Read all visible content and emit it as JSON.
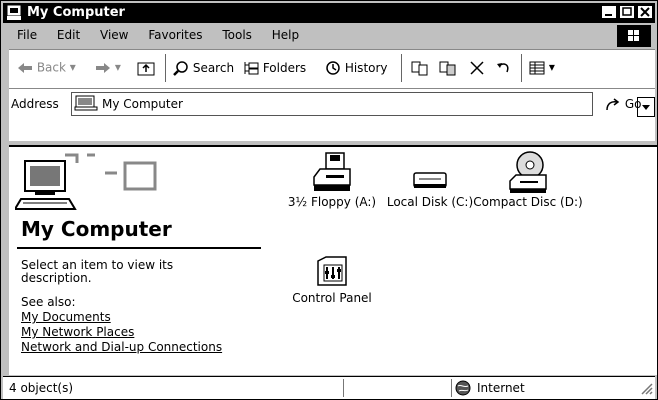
{
  "window": {
    "title": "My Computer"
  },
  "menu": [
    "File",
    "Edit",
    "View",
    "Favorites",
    "Tools",
    "Help"
  ],
  "toolbar": {
    "back": "Back",
    "search": "Search",
    "folders": "Folders",
    "history": "History"
  },
  "address": {
    "label": "Address",
    "value": "My Computer",
    "go": "Go"
  },
  "left_pane": {
    "title": "My Computer",
    "description": "Select an item to view its description.",
    "see_also": "See also:",
    "links": [
      "My Documents",
      "My Network Places",
      "Network and Dial-up Connections"
    ]
  },
  "items": [
    {
      "label": "3½ Floppy (A:)",
      "icon": "floppy-drive-icon"
    },
    {
      "label": "Local Disk (C:)",
      "icon": "hard-disk-icon"
    },
    {
      "label": "Compact Disc (D:)",
      "icon": "cd-drive-icon"
    },
    {
      "label": "Control Panel",
      "icon": "control-panel-icon"
    }
  ],
  "status": {
    "objects": "4 object(s)",
    "zone": "Internet"
  },
  "colors": {
    "titlebar": "#000000",
    "chrome": "#c0c0c0",
    "background": "#ffffff"
  }
}
